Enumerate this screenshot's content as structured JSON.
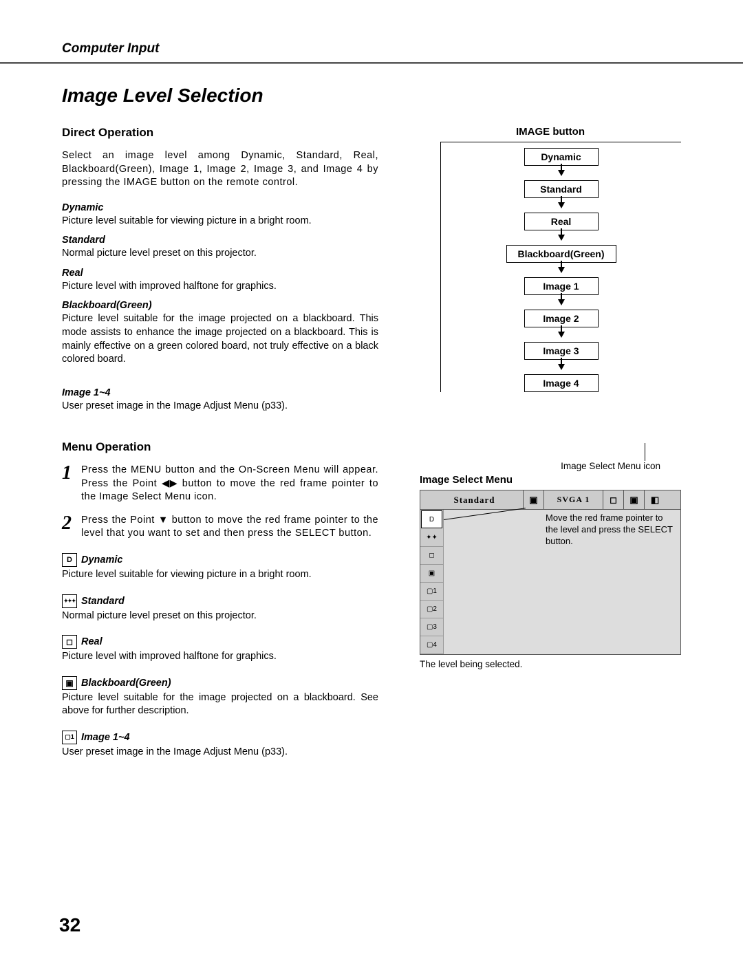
{
  "header": {
    "section": "Computer Input"
  },
  "title": "Image Level Selection",
  "direct": {
    "heading": "Direct Operation",
    "intro": "Select an image level among Dynamic, Standard, Real, Blackboard(Green), Image 1, Image 2, Image 3, and Image 4 by pressing the IMAGE button on the remote control.",
    "modes": {
      "dynamic": {
        "label": "Dynamic",
        "desc": "Picture level suitable for viewing picture in a bright room."
      },
      "standard": {
        "label": "Standard",
        "desc": "Normal picture level preset on this projector."
      },
      "real": {
        "label": "Real",
        "desc": "Picture level with improved halftone for graphics."
      },
      "bb": {
        "label": "Blackboard(Green)",
        "desc": "Picture level suitable for the image projected on a blackboard. This mode assists to enhance the image projected on a blackboard.  This is mainly effective on a green colored board, not truly effective on a black colored board."
      },
      "img14": {
        "label": "Image 1~4",
        "desc": "User preset image in the Image Adjust Menu (p33)."
      }
    }
  },
  "menu": {
    "heading": "Menu Operation",
    "step1": {
      "num": "1",
      "text_a": "Press the MENU button and the On-Screen Menu will appear.  Press the Point ",
      "text_b": " button to move the red frame pointer to the Image Select Menu icon."
    },
    "step2": {
      "num": "2",
      "text_a": "Press the Point ",
      "text_b": " button to move the red frame pointer to the level that you want to set and then press the SELECT button."
    },
    "modes": {
      "dynamic": {
        "label": "Dynamic",
        "desc": "Picture level suitable for viewing picture in a bright room."
      },
      "standard": {
        "label": "Standard",
        "desc": "Normal picture level preset on this projector."
      },
      "real": {
        "label": "Real",
        "desc": "Picture level with improved halftone for graphics."
      },
      "bb": {
        "label": "Blackboard(Green)",
        "desc": "Picture level suitable for the image projected on a blackboard. See above for further description."
      },
      "img14": {
        "label": "Image 1~4",
        "desc": "User preset image in the Image Adjust Menu (p33)."
      }
    }
  },
  "flow": {
    "title": "IMAGE button",
    "items": [
      "Dynamic",
      "Standard",
      "Real",
      "Blackboard(Green)",
      "Image 1",
      "Image 2",
      "Image 3",
      "Image 4"
    ]
  },
  "ism": {
    "icon_label": "Image Select Menu icon",
    "title": "Image Select Menu",
    "bar_std": "Standard",
    "bar_sv": "SVGA 1",
    "tip": "Move the red frame pointer to the level and press the SELECT button.",
    "caption": "The level being selected.",
    "side_items": [
      "D",
      "✦",
      "◻",
      "▣",
      "1",
      "2",
      "3",
      "4"
    ]
  },
  "page": "32"
}
